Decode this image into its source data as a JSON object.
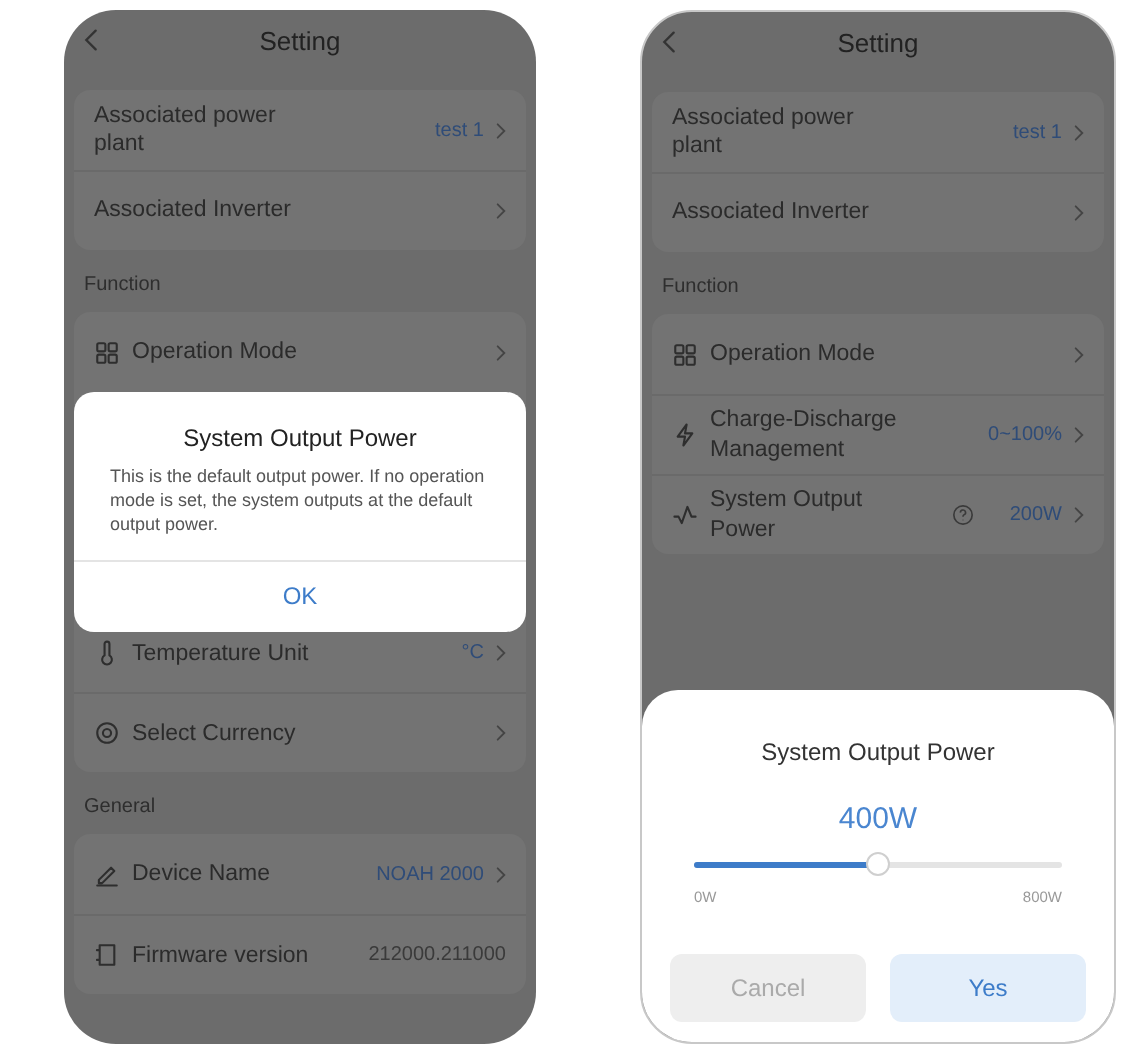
{
  "phones": [
    {
      "title": "Setting",
      "back": true,
      "sections": [
        {
          "rows": [
            {
              "kind": "plain",
              "label": "Associated power plant",
              "value": "test 1",
              "accent": true,
              "chevron": true,
              "help": false
            },
            {
              "kind": "plain",
              "label": "Associated Inverter",
              "chevron": true,
              "help": false
            }
          ]
        },
        {
          "label": "Function",
          "rows": [
            {
              "kind": "grid",
              "label": "Operation Mode",
              "chevron": true,
              "help": false
            },
            {
              "kind": "dialog",
              "title": "System Output Power",
              "message": "This is the default output power. If no operation mode is set, the system outputs at the default output power.",
              "button": "OK"
            },
            {
              "kind": "thermometer",
              "label": "Temperature Unit",
              "value": "°C",
              "accent": true,
              "chevron": true,
              "help": false
            },
            {
              "kind": "target",
              "label": "Select Currency",
              "chevron": true,
              "help": false
            }
          ]
        },
        {
          "label": "General",
          "rows": [
            {
              "kind": "pen",
              "label": "Device Name",
              "value": "NOAH 2000",
              "accent": true,
              "chevron": true,
              "help": false
            },
            {
              "kind": "chip",
              "label": "Firmware version",
              "value": "212000.211000",
              "accent": false,
              "chevron": false,
              "help": false
            }
          ]
        }
      ]
    },
    {
      "title": "Setting",
      "back": true,
      "sections": [
        {
          "rows": [
            {
              "kind": "plain",
              "label": "Associated power plant",
              "value": "test 1",
              "accent": true,
              "chevron": true,
              "help": false
            },
            {
              "kind": "plain",
              "label": "Associated Inverter",
              "chevron": true,
              "help": false
            }
          ]
        },
        {
          "label": "Function",
          "rows": [
            {
              "kind": "grid",
              "label": "Operation Mode",
              "chevron": true,
              "help": false
            },
            {
              "kind": "bolt",
              "label": "Charge-Discharge Management",
              "value": "0~100%",
              "accent": true,
              "chevron": true,
              "help": false
            },
            {
              "kind": "wave",
              "label": "System Output Power",
              "value": "200W",
              "accent": true,
              "chevron": true,
              "help": true
            }
          ]
        }
      ],
      "sheet": {
        "title": "System Output Power",
        "value": "400W",
        "level": 0.5,
        "min_label": "0W",
        "max_label": "800W",
        "buttons": [
          {
            "label": "Cancel",
            "kind": "secondary"
          },
          {
            "label": "Yes",
            "kind": "primary"
          }
        ]
      }
    }
  ]
}
